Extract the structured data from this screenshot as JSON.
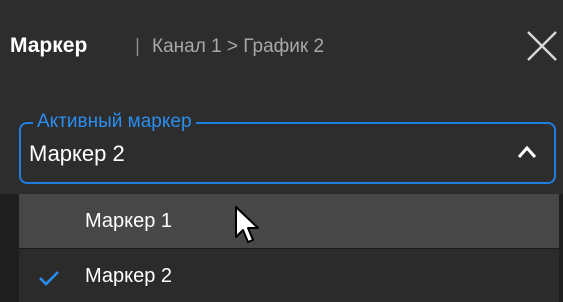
{
  "header": {
    "title": "Маркер",
    "separator": "|",
    "breadcrumb": "Канал 1 > График 2",
    "close_icon": "close-icon"
  },
  "active_marker": {
    "legend": "Активный маркер",
    "value": "Маркер 2",
    "chevron_icon": "chevron-up-icon",
    "expanded": true
  },
  "options": [
    {
      "label": "Маркер 1",
      "hovered": true,
      "selected": false
    },
    {
      "label": "Маркер 2",
      "hovered": false,
      "selected": true,
      "check_icon": "check-icon"
    }
  ],
  "colors": {
    "accent": "#1f7fe0",
    "background": "#1e1e1e",
    "panel": "#2d2d2d",
    "hover": "#474747"
  }
}
